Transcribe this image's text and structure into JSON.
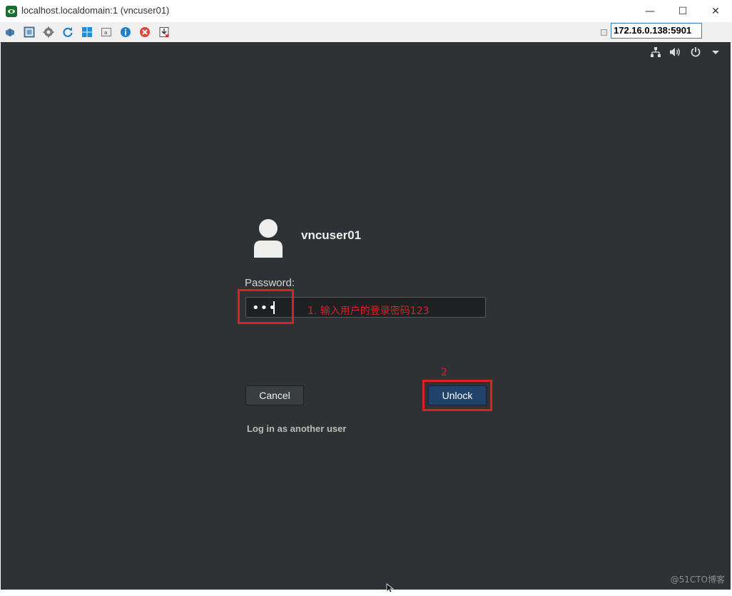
{
  "window": {
    "title": "localhost.localdomain:1 (vncuser01)",
    "minimize_glyph": "—",
    "maximize_glyph": "☐",
    "close_glyph": "✕"
  },
  "toolbar": {
    "icons": [
      "options-icon",
      "fullscreen-icon",
      "settings-icon",
      "refresh-icon",
      "windows-key-icon",
      "send-keys-icon",
      "info-icon",
      "disconnect-icon",
      "transfer-icon"
    ],
    "address": "172.16.0.138:5901"
  },
  "lock_screen": {
    "username": "vncuser01",
    "password_label": "Password:",
    "password_value": "•••",
    "cancel_label": "Cancel",
    "unlock_label": "Unlock",
    "other_user_label": "Log in as another user"
  },
  "annotations": {
    "step1": "1. 输入用户的登录密码123",
    "step2": "2"
  },
  "watermark": "@51CTO博客",
  "colors": {
    "desktop_bg": "#2f3234",
    "accent_button": "#21426b",
    "annotation_red": "#d8222a"
  }
}
